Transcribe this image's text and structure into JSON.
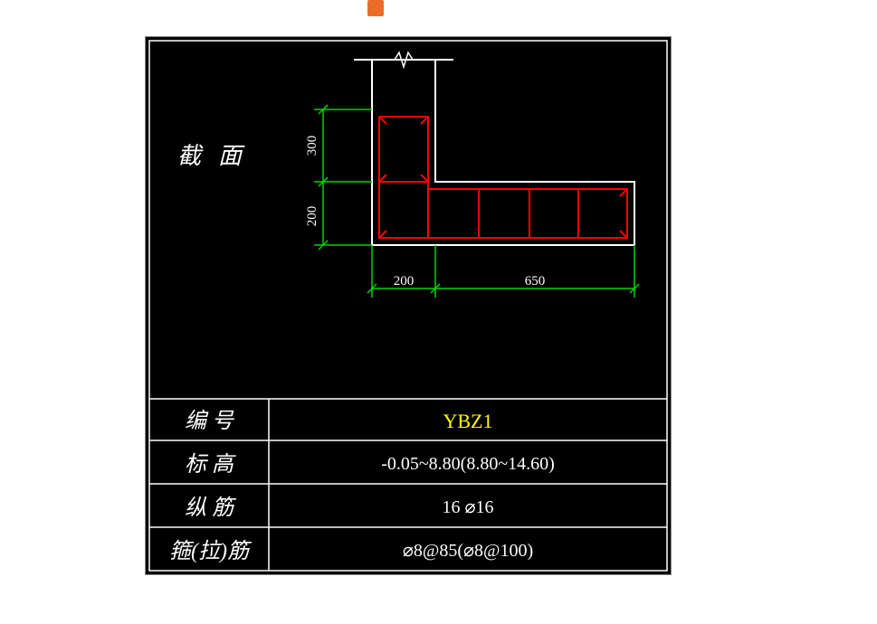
{
  "icon": "comment-icon",
  "drawing": {
    "section_label_a": "截",
    "section_label_b": "面",
    "dims": {
      "v1": "300",
      "v2": "200",
      "h1": "200",
      "h2": "650"
    },
    "rows": {
      "r1_label": "编  号",
      "r1_value": "YBZ1",
      "r2_label": "标  高",
      "r2_value": "-0.05~8.80(8.80~14.60)",
      "r3_label": "纵  筋",
      "r3_value": "16 ⌀16",
      "r4_label": "箍(拉)筋",
      "r4_value": "⌀8@85(⌀8@100)"
    }
  }
}
